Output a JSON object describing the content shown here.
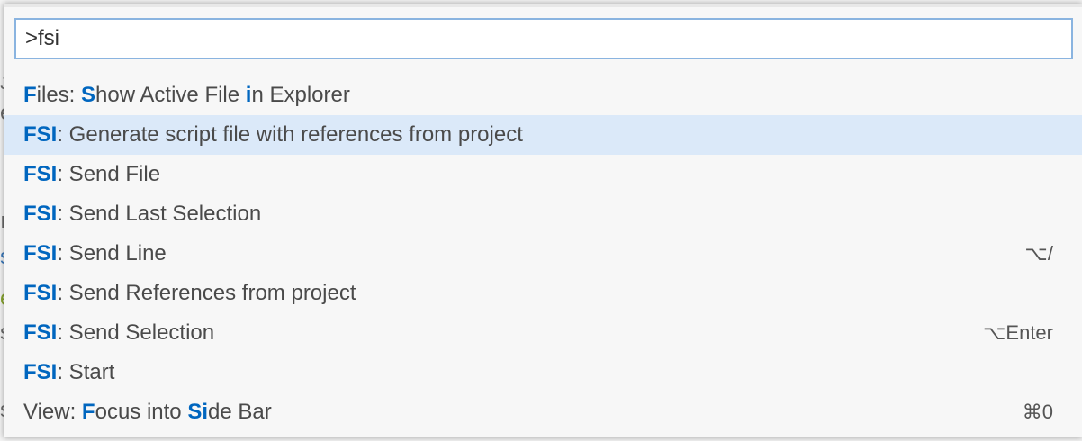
{
  "search": {
    "value": ">fsi"
  },
  "background_chars": [
    "ᴊ",
    "e",
    "ı",
    "s",
    "e",
    "s",
    "s"
  ],
  "commands": [
    {
      "segments": [
        {
          "t": "F",
          "h": true
        },
        {
          "t": "iles: ",
          "h": false
        },
        {
          "t": "S",
          "h": true
        },
        {
          "t": "how Active File ",
          "h": false
        },
        {
          "t": "i",
          "h": true
        },
        {
          "t": "n Explorer",
          "h": false
        }
      ],
      "keybinding": "",
      "selected": false
    },
    {
      "segments": [
        {
          "t": "FSI",
          "h": true
        },
        {
          "t": ": Generate script file with references from project",
          "h": false
        }
      ],
      "keybinding": "",
      "selected": true
    },
    {
      "segments": [
        {
          "t": "FSI",
          "h": true
        },
        {
          "t": ": Send File",
          "h": false
        }
      ],
      "keybinding": "",
      "selected": false
    },
    {
      "segments": [
        {
          "t": "FSI",
          "h": true
        },
        {
          "t": ": Send Last Selection",
          "h": false
        }
      ],
      "keybinding": "",
      "selected": false
    },
    {
      "segments": [
        {
          "t": "FSI",
          "h": true
        },
        {
          "t": ": Send Line",
          "h": false
        }
      ],
      "keybinding": "⌥/",
      "selected": false
    },
    {
      "segments": [
        {
          "t": "FSI",
          "h": true
        },
        {
          "t": ": Send References from project",
          "h": false
        }
      ],
      "keybinding": "",
      "selected": false
    },
    {
      "segments": [
        {
          "t": "FSI",
          "h": true
        },
        {
          "t": ": Send Selection",
          "h": false
        }
      ],
      "keybinding": "⌥Enter",
      "selected": false
    },
    {
      "segments": [
        {
          "t": "FSI",
          "h": true
        },
        {
          "t": ": Start",
          "h": false
        }
      ],
      "keybinding": "",
      "selected": false
    },
    {
      "segments": [
        {
          "t": "View: ",
          "h": false
        },
        {
          "t": "F",
          "h": true
        },
        {
          "t": "ocus into ",
          "h": false
        },
        {
          "t": "Si",
          "h": true
        },
        {
          "t": "de Bar",
          "h": false
        }
      ],
      "keybinding": "⌘0",
      "selected": false
    }
  ],
  "colors": {
    "highlight": "#0066bf",
    "selected_background": "#dbe9f9",
    "input_border": "#8ab4e0"
  }
}
